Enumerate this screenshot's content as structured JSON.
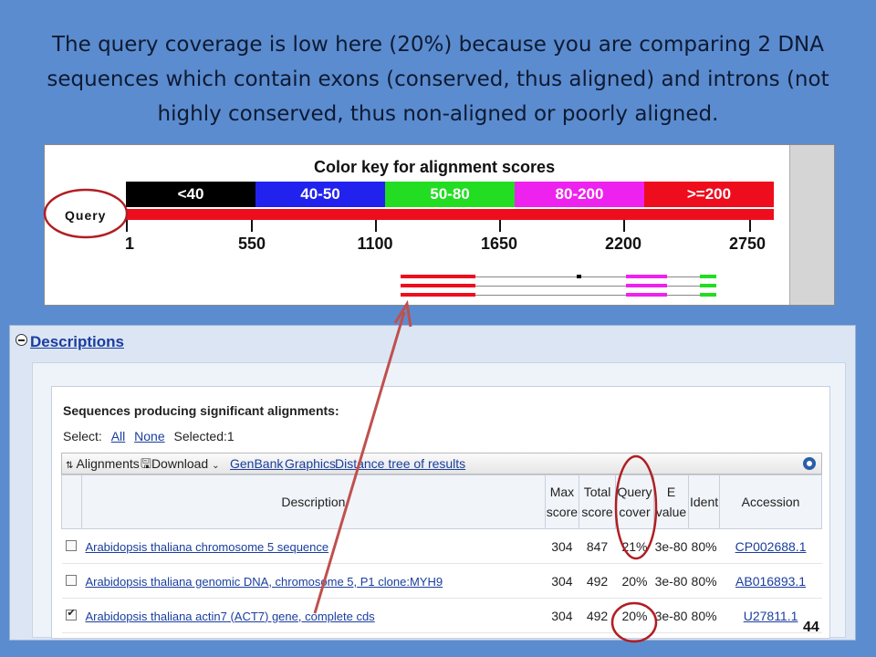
{
  "slide": {
    "title": "The query coverage is low here (20%) because you are comparing 2 DNA sequences which contain exons (conserved, thus aligned)  and introns (not highly conserved, thus non-aligned or poorly aligned.",
    "page_number": "44"
  },
  "color_key": {
    "title": "Color key for alignment scores",
    "segments": [
      {
        "label": "<40",
        "color": "#000000"
      },
      {
        "label": "40-50",
        "color": "#2222ee"
      },
      {
        "label": "50-80",
        "color": "#22dd22"
      },
      {
        "label": "80-200",
        "color": "#ee22ee"
      },
      {
        "label": ">=200",
        "color": "#ee0d1d"
      }
    ],
    "query_label": "Query",
    "ticks": [
      "1",
      "550",
      "1100",
      "1650",
      "2200",
      "2750"
    ]
  },
  "descriptions": {
    "heading": "Descriptions",
    "section_title": "Sequences producing significant alignments:",
    "select_label": "Select:",
    "select_all": "All",
    "select_none": "None",
    "selected_label": "Selected:1",
    "toolbar": {
      "alignments": "Alignments",
      "download": "Download",
      "genbank": "GenBank",
      "graphics": "Graphics",
      "distance_tree": "Distance tree of results"
    },
    "columns": {
      "description": "Description",
      "max_score_1": "Max",
      "max_score_2": "score",
      "total_score_1": "Total",
      "total_score_2": "score",
      "query_cover_1": "Query",
      "query_cover_2": "cover",
      "evalue_1": "E",
      "evalue_2": "value",
      "ident": "Ident",
      "accession": "Accession"
    },
    "rows": [
      {
        "checked": false,
        "description": "Arabidopsis thaliana chromosome 5 sequence",
        "max_score": "304",
        "total_score": "847",
        "query_cover": "21%",
        "evalue": "3e-80",
        "ident": "80%",
        "accession": "CP002688.1"
      },
      {
        "checked": false,
        "description": "Arabidopsis thaliana genomic DNA, chromosome 5, P1 clone:MYH9",
        "max_score": "304",
        "total_score": "492",
        "query_cover": "20%",
        "evalue": "3e-80",
        "ident": "80%",
        "accession": "AB016893.1"
      },
      {
        "checked": true,
        "description": "Arabidopsis thaliana actin7 (ACT7) gene, complete cds",
        "max_score": "304",
        "total_score": "492",
        "query_cover": "20%",
        "evalue": "3e-80",
        "ident": "80%",
        "accession": "U27811.1"
      }
    ]
  },
  "annotation_colors": {
    "circle": "#b01e23",
    "arrow": "#c0504d"
  }
}
